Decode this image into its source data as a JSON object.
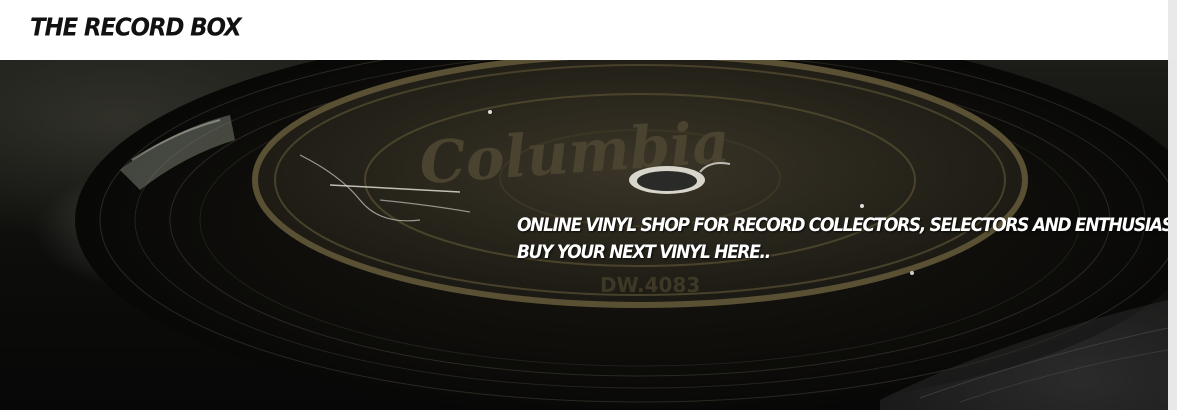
{
  "header": {
    "site_title": "THE RECORD BOX"
  },
  "hero": {
    "tagline_line1": "ONLINE VINYL SHOP FOR RECORD COLLECTORS, SELECTORS AND ENTHUSIASTS.",
    "tagline_line2": "BUY YOUR NEXT VINYL HERE..",
    "image_label_text": "Columbia",
    "image_catalog_text": "DW.4083"
  },
  "colors": {
    "header_bg": "#ffffff",
    "title_text": "#111111",
    "hero_text": "#ffffff"
  }
}
